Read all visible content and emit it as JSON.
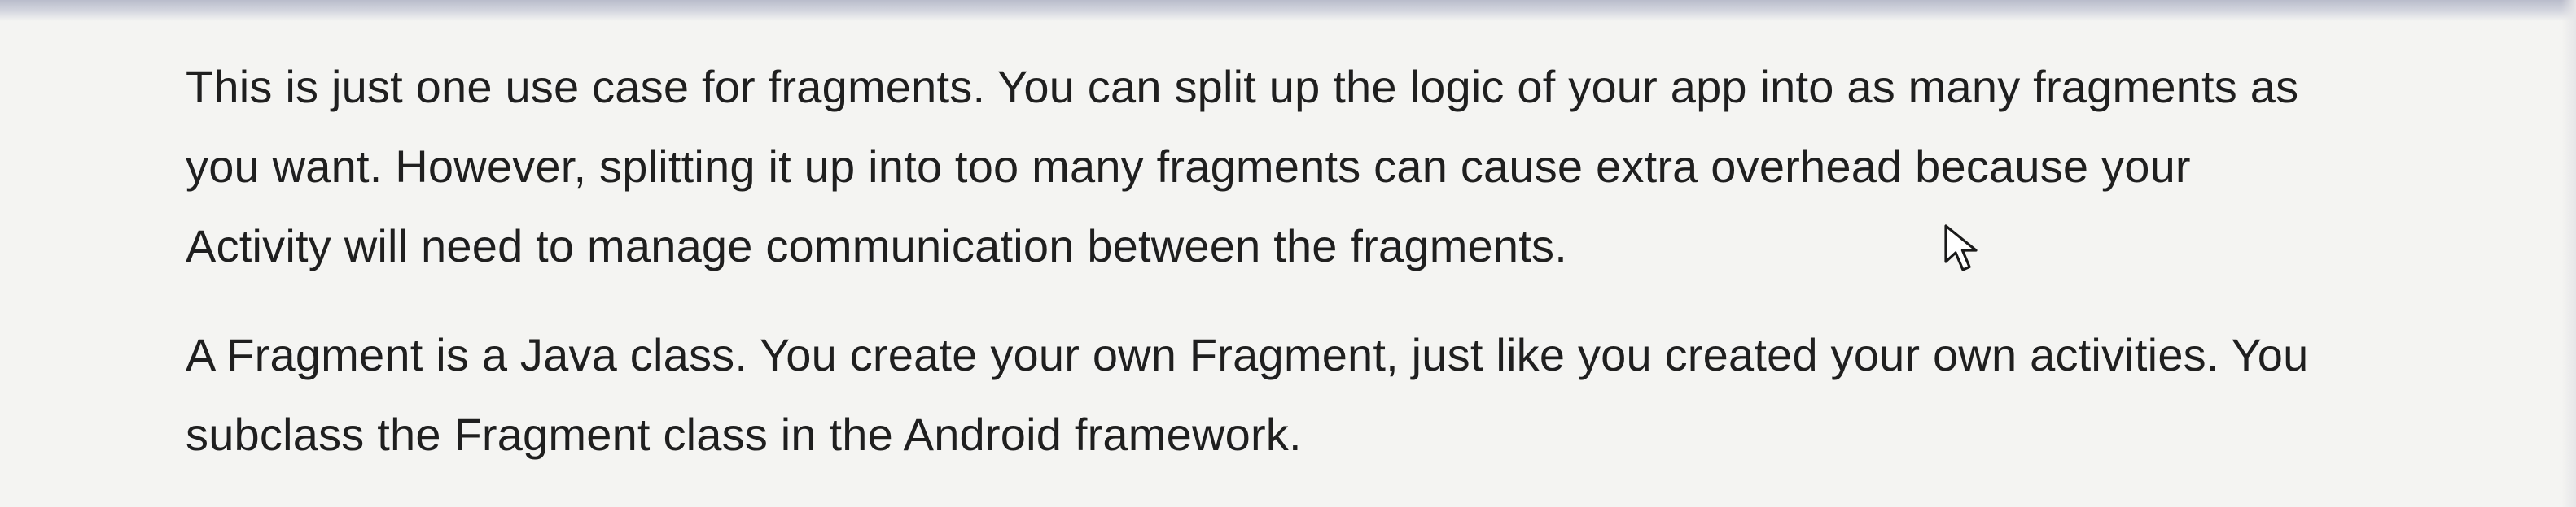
{
  "article": {
    "paragraphs": [
      {
        "lines": [
          "This is just one use case for fragments. You can split up the logic of your app into as many fragments as",
          "you want. However, splitting it up into too many fragments can cause extra overhead because your",
          "Activity will need to manage communication between the fragments."
        ]
      },
      {
        "lines": [
          "A Fragment is a Java class. You create your own Fragment, just like you created your own activities. You",
          "subclass the Fragment class in the Android framework."
        ]
      }
    ]
  },
  "cursor": {
    "icon": "mouse-pointer-icon"
  }
}
